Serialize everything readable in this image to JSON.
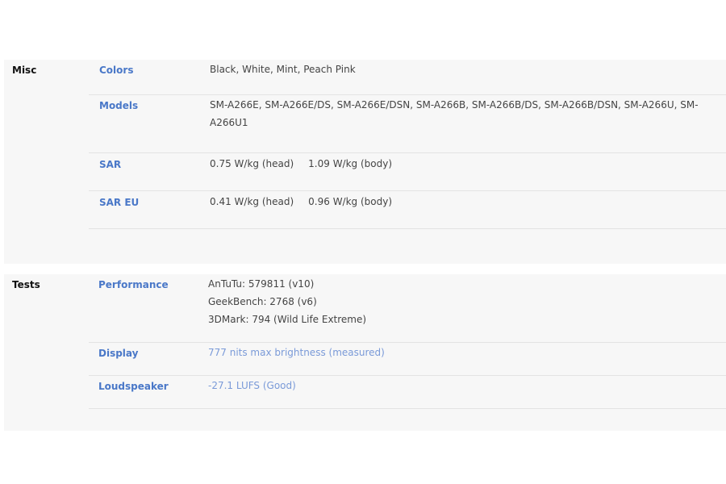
{
  "misc": {
    "title": "Misc",
    "rows": [
      {
        "label": "Colors",
        "value": "Black, White, Mint, Peach Pink"
      },
      {
        "label": "Models",
        "value": "SM-A266E, SM-A266E/DS, SM-A266E/DSN, SM-A266B, SM-A266B/DS, SM-A266B/DSN, SM-A266U, SM-A266U1"
      },
      {
        "label": "SAR",
        "value_head": "0.75 W/kg (head)",
        "value_body": "1.09 W/kg (body)"
      },
      {
        "label": "SAR EU",
        "value_head": "0.41 W/kg (head)",
        "value_body": "0.96 W/kg (body)"
      }
    ]
  },
  "tests": {
    "title": "Tests",
    "rows": [
      {
        "label": "Performance",
        "lines": [
          "AnTuTu: 579811 (v10)",
          "GeekBench: 2768 (v6)",
          "3DMark: 794 (Wild Life Extreme)"
        ]
      },
      {
        "label": "Display",
        "value": "777 nits max brightness (measured)"
      },
      {
        "label": "Loudspeaker",
        "value": "-27.1 LUFS (Good)"
      }
    ]
  },
  "colors": {
    "label_accent": "#4a78c8",
    "link_value": "#7a9ad8",
    "section_bg": "#f7f7f7"
  }
}
